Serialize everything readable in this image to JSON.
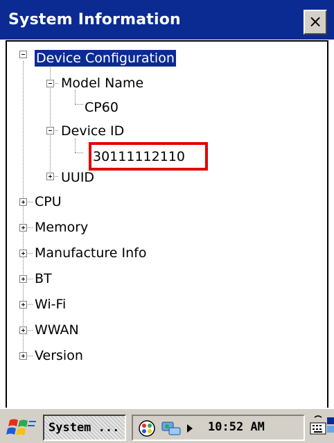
{
  "window": {
    "title": "System Information",
    "close_label": "×"
  },
  "tree": {
    "nodes": [
      {
        "label": "Device Configuration",
        "expanded": true,
        "selected": true
      },
      {
        "label": "Model Name",
        "expanded": true
      },
      {
        "label": "CP60"
      },
      {
        "label": "Device ID",
        "expanded": true
      },
      {
        "label": "30111112110",
        "highlighted": true
      },
      {
        "label": "UUID",
        "expanded": false
      },
      {
        "label": "CPU",
        "expanded": false
      },
      {
        "label": "Memory",
        "expanded": false
      },
      {
        "label": "Manufacture Info",
        "expanded": false
      },
      {
        "label": "BT",
        "expanded": false
      },
      {
        "label": "Wi-Fi",
        "expanded": false
      },
      {
        "label": "WWAN",
        "expanded": false
      },
      {
        "label": "Version",
        "expanded": false
      }
    ]
  },
  "taskbar": {
    "task_label": "System ...",
    "time": "10:52 AM",
    "icons": [
      "windows-start-icon",
      "network-icon",
      "connection-icon",
      "tray-arrow-icon",
      "keyboard-icon",
      "desktop-icon"
    ]
  },
  "colors": {
    "titlebar": "#0b2b93",
    "highlight_border": "#e00000",
    "chrome": "#d4d0c8"
  }
}
